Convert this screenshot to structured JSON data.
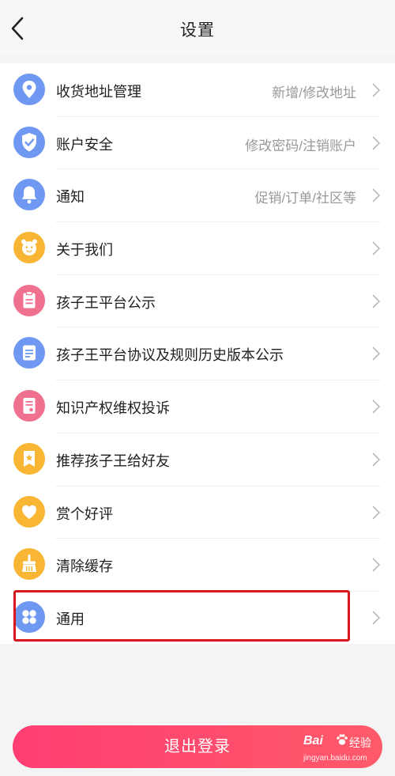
{
  "header": {
    "title": "设置",
    "back_icon": "chevron-left-icon"
  },
  "settings": {
    "items": [
      {
        "label": "收货地址管理",
        "hint": "新增/修改地址",
        "icon": "location-pin-icon",
        "icon_color": "#6f98f2"
      },
      {
        "label": "账户安全",
        "hint": "修改密码/注销账户",
        "icon": "shield-check-icon",
        "icon_color": "#6f98f2"
      },
      {
        "label": "通知",
        "hint": "促销/订单/社区等",
        "icon": "bell-icon",
        "icon_color": "#6f98f2"
      },
      {
        "label": "关于我们",
        "hint": "",
        "icon": "mascot-face-icon",
        "icon_color": "#f9b634"
      },
      {
        "label": "孩子王平台公示",
        "hint": "",
        "icon": "clipboard-icon",
        "icon_color": "#f0708f"
      },
      {
        "label": "孩子王平台协议及规则历史版本公示",
        "hint": "",
        "icon": "document-icon",
        "icon_color": "#6f98f2"
      },
      {
        "label": "知识产权维权投诉",
        "hint": "",
        "icon": "report-icon",
        "icon_color": "#f0708f"
      },
      {
        "label": "推荐孩子王给好友",
        "hint": "",
        "icon": "badge-icon",
        "icon_color": "#f9b634"
      },
      {
        "label": "赏个好评",
        "hint": "",
        "icon": "heart-icon",
        "icon_color": "#f9b634"
      },
      {
        "label": "清除缓存",
        "hint": "",
        "icon": "broom-icon",
        "icon_color": "#f9b634"
      },
      {
        "label": "通用",
        "hint": "",
        "icon": "grid-icon",
        "icon_color": "#6f98f2"
      }
    ]
  },
  "logout": {
    "label": "退出登录",
    "color": "#ff4b6d"
  },
  "watermark": {
    "brand": "Bai",
    "suffix": "经验",
    "url": "jingyan.baidu.com"
  },
  "highlight_color": "#d7191f"
}
